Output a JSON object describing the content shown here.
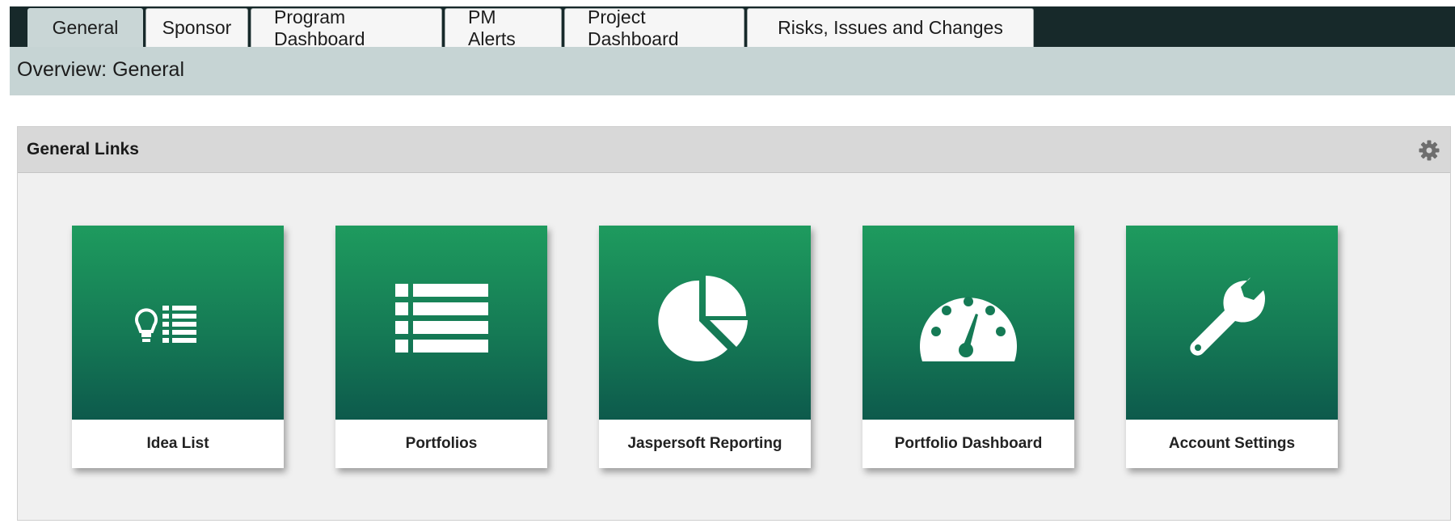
{
  "tabs": [
    {
      "label": "General",
      "active": true
    },
    {
      "label": "Sponsor",
      "active": false
    },
    {
      "label": "Program Dashboard",
      "active": false
    },
    {
      "label": "PM Alerts",
      "active": false
    },
    {
      "label": "Project Dashboard",
      "active": false
    },
    {
      "label": "Risks, Issues and Changes",
      "active": false
    }
  ],
  "subheader": {
    "title": "Overview: General"
  },
  "panel": {
    "title": "General Links",
    "settings_icon": "gear-icon"
  },
  "tiles": [
    {
      "label": "Idea List",
      "icon": "lightbulb-list-icon"
    },
    {
      "label": "Portfolios",
      "icon": "list-icon"
    },
    {
      "label": "Jaspersoft Reporting",
      "icon": "pie-chart-icon"
    },
    {
      "label": "Portfolio Dashboard",
      "icon": "speedometer-icon"
    },
    {
      "label": "Account Settings",
      "icon": "wrench-icon"
    }
  ],
  "colors": {
    "topbar": "#17292a",
    "subheader": "#c6d4d4",
    "active_tab": "#c9d6d6",
    "tile_gradient_top": "#1e9b5e",
    "tile_gradient_bottom": "#0d5a4c"
  }
}
